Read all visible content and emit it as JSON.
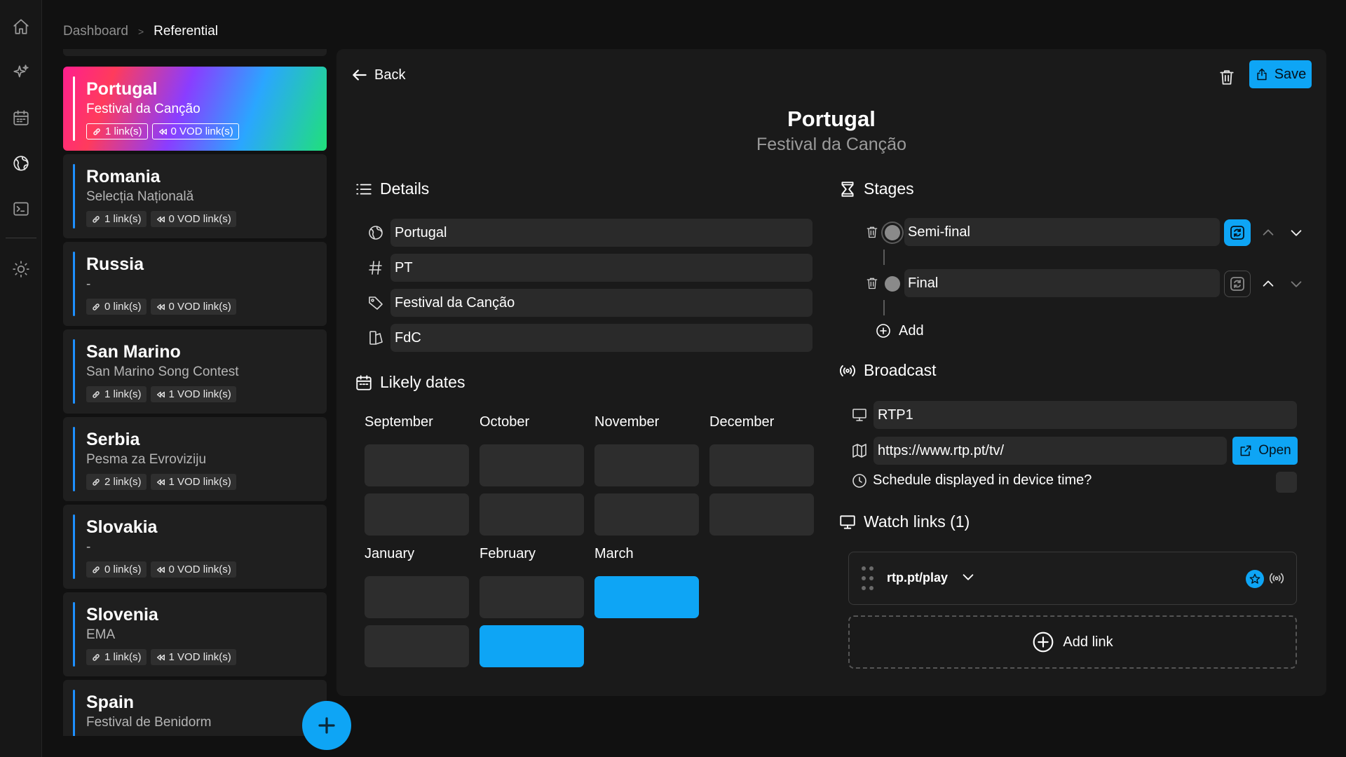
{
  "nav_rail": {
    "items": [
      {
        "icon": "home-icon",
        "active": false
      },
      {
        "icon": "sparkles-icon",
        "active": false
      },
      {
        "icon": "calendar-icon",
        "active": false
      },
      {
        "icon": "globe-icon",
        "active": true
      },
      {
        "icon": "terminal-icon",
        "active": false
      },
      {
        "icon": "sun-icon",
        "active": false
      }
    ]
  },
  "breadcrumb": {
    "parent": "Dashboard",
    "separator": ">",
    "current": "Referential"
  },
  "entries": [
    {
      "country": "Portugal",
      "event": "Festival da Canção",
      "links": "1 link(s)",
      "vod": "0 VOD link(s)",
      "selected": true
    },
    {
      "country": "Romania",
      "event": "Selecția Națională",
      "links": "1 link(s)",
      "vod": "0 VOD link(s)",
      "selected": false
    },
    {
      "country": "Russia",
      "event": "-",
      "links": "0 link(s)",
      "vod": "0 VOD link(s)",
      "selected": false
    },
    {
      "country": "San Marino",
      "event": "San Marino Song Contest",
      "links": "1 link(s)",
      "vod": "1 VOD link(s)",
      "selected": false
    },
    {
      "country": "Serbia",
      "event": "Pesma za Evroviziju",
      "links": "2 link(s)",
      "vod": "1 VOD link(s)",
      "selected": false
    },
    {
      "country": "Slovakia",
      "event": "-",
      "links": "0 link(s)",
      "vod": "0 VOD link(s)",
      "selected": false
    },
    {
      "country": "Slovenia",
      "event": "EMA",
      "links": "1 link(s)",
      "vod": "1 VOD link(s)",
      "selected": false
    },
    {
      "country": "Spain",
      "event": "Festival de Benidorm",
      "links": "",
      "vod": "",
      "selected": false
    }
  ],
  "detail": {
    "back_label": "Back",
    "save_label": "Save",
    "title": "Portugal",
    "subtitle": "Festival da Canção",
    "details": {
      "heading": "Details",
      "country": "Portugal",
      "code": "PT",
      "event_name": "Festival da Canção",
      "short_name": "FdC"
    },
    "likely_dates": {
      "heading": "Likely dates",
      "months_row1": [
        "September",
        "October",
        "November",
        "December"
      ],
      "months_row2": [
        "January",
        "February",
        "March"
      ],
      "selected": {
        "February": [
          false,
          true
        ],
        "March": [
          true,
          false
        ]
      }
    },
    "stages": {
      "heading": "Stages",
      "items": [
        {
          "name": "Semi-final",
          "sync_active": true
        },
        {
          "name": "Final",
          "sync_active": false
        }
      ],
      "add_label": "Add"
    },
    "broadcast": {
      "heading": "Broadcast",
      "channel": "RTP1",
      "url": "https://www.rtp.pt/tv/",
      "open_label": "Open",
      "schedule_label": "Schedule displayed in device time?",
      "schedule_device_time": false
    },
    "watch_links": {
      "heading": "Watch links (1)",
      "items": [
        {
          "name": "rtp.pt/play"
        }
      ],
      "add_label": "Add link"
    }
  },
  "colors": {
    "accent": "#0ea5f5",
    "background": "#111111",
    "panel": "#1a1a1a",
    "card": "#1f1f1f",
    "field": "#2a2a2a"
  }
}
